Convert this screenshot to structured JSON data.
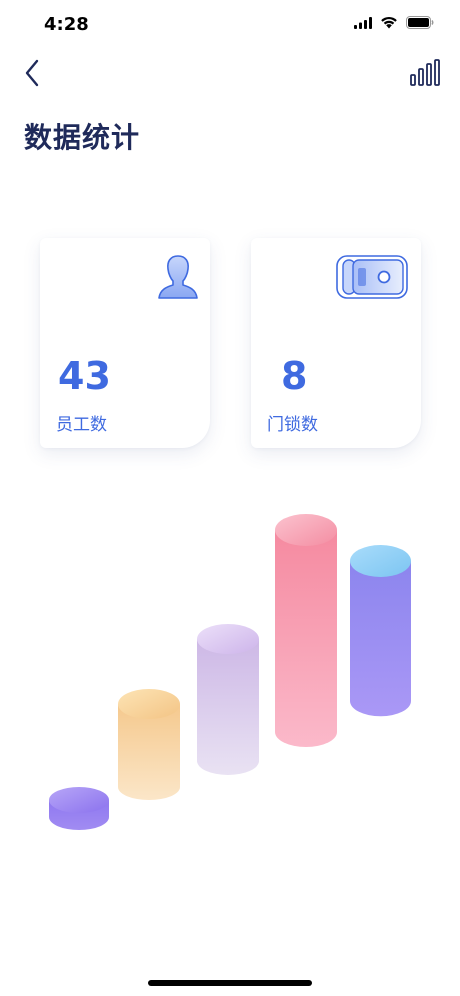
{
  "status_bar": {
    "time": "4:28"
  },
  "header": {
    "title": "数据统计",
    "back_icon": "chevron-left-icon",
    "stats_icon": "bar-chart-icon"
  },
  "cards": {
    "employees": {
      "value": "43",
      "label": "员工数",
      "icon": "person-icon"
    },
    "locks": {
      "value": "8",
      "label": "门锁数",
      "icon": "door-lock-icon"
    }
  },
  "colors": {
    "accent": "#3f6ae0",
    "title": "#1f2a5a"
  }
}
